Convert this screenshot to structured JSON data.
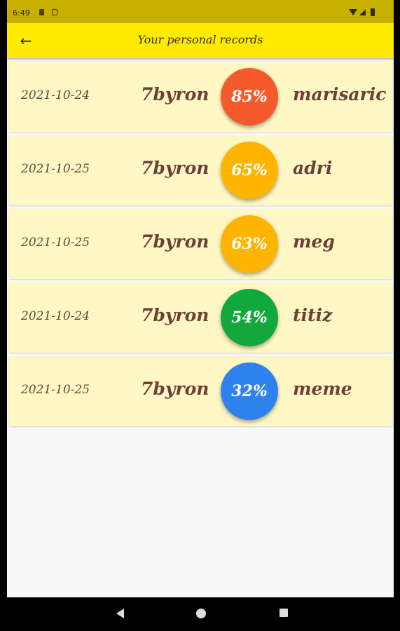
{
  "status_bar": {
    "time": "6:49",
    "icons": [
      "sim-card-icon",
      "storage-icon",
      "wifi-icon",
      "signal-icon",
      "battery-icon"
    ]
  },
  "app_bar": {
    "title": "Your personal records",
    "back_icon": "arrow-left-icon"
  },
  "records": [
    {
      "date": "2021-10-24",
      "user": "7byron",
      "score": "85%",
      "score_color": "#f55a2c",
      "opponent": "marisaric"
    },
    {
      "date": "2021-10-25",
      "user": "7byron",
      "score": "65%",
      "score_color": "#ffb400",
      "opponent": "adri"
    },
    {
      "date": "2021-10-25",
      "user": "7byron",
      "score": "63%",
      "score_color": "#ffb400",
      "opponent": "meg"
    },
    {
      "date": "2021-10-24",
      "user": "7byron",
      "score": "54%",
      "score_color": "#12a83c",
      "opponent": "titiz"
    },
    {
      "date": "2021-10-25",
      "user": "7byron",
      "score": "32%",
      "score_color": "#2e82f0",
      "opponent": "meme"
    }
  ],
  "colors": {
    "app_bar": "#ffea00",
    "status_bar": "#c7b000",
    "card_background": "#fff8c4",
    "text_primary": "#6e3f36"
  },
  "nav_bar": {
    "icons": [
      "back-triangle-icon",
      "home-circle-icon",
      "recents-square-icon"
    ]
  }
}
